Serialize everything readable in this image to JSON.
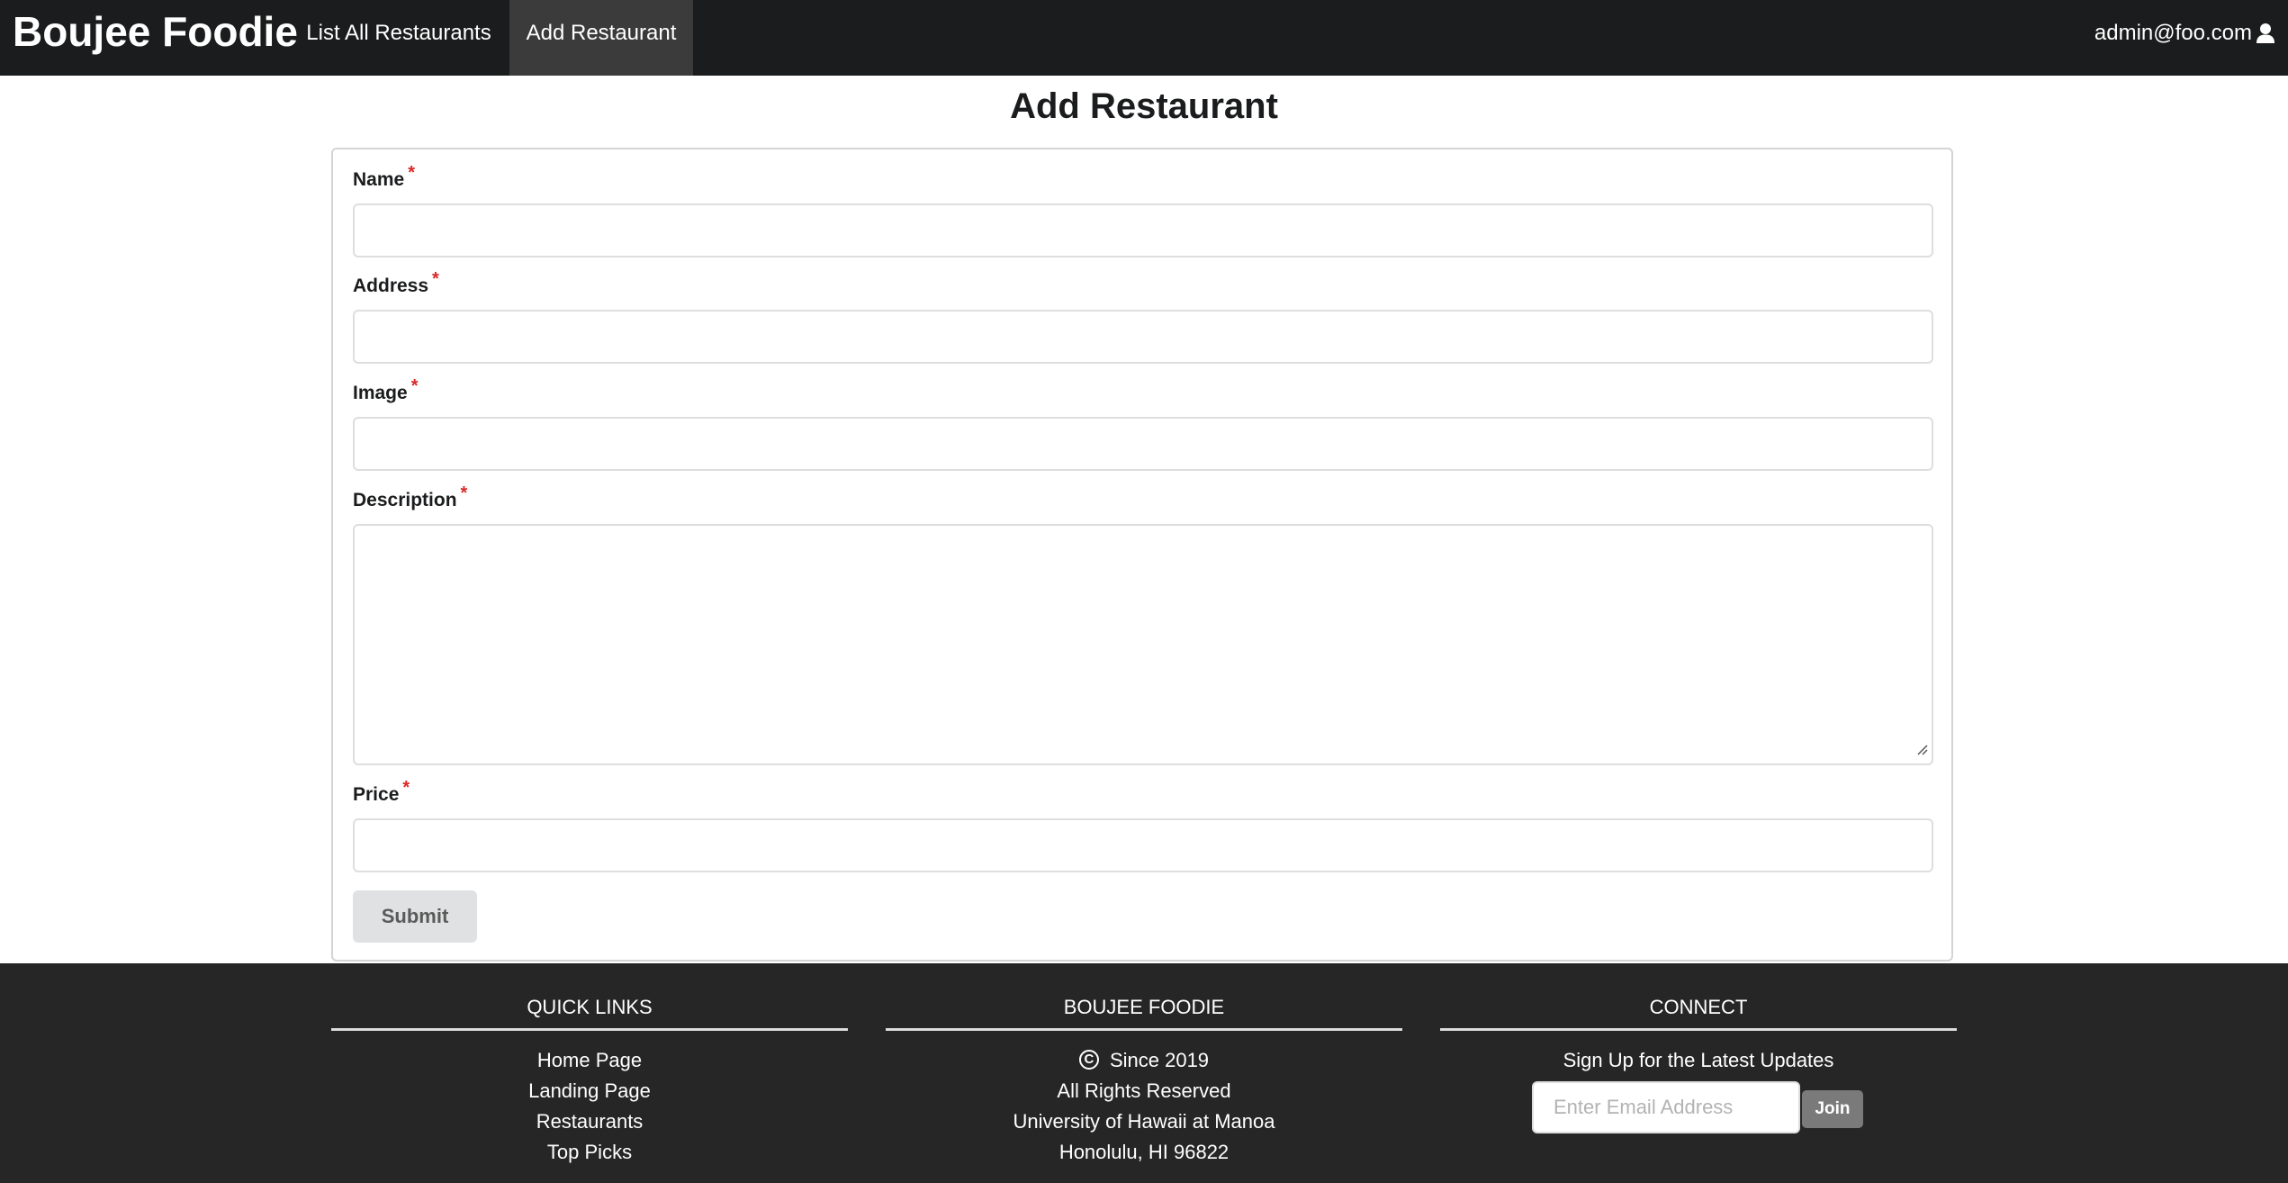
{
  "navbar": {
    "brand": "Boujee Foodie",
    "items": [
      {
        "label": "List All Restaurants",
        "active": false
      },
      {
        "label": "Add Restaurant",
        "active": true
      }
    ],
    "user": "admin@foo.com",
    "user_icon": "user-icon"
  },
  "page": {
    "title": "Add Restaurant"
  },
  "form": {
    "required_mark": "*",
    "fields": {
      "name": {
        "label": "Name",
        "value": ""
      },
      "address": {
        "label": "Address",
        "value": ""
      },
      "image": {
        "label": "Image",
        "value": ""
      },
      "description": {
        "label": "Description",
        "value": ""
      },
      "price": {
        "label": "Price",
        "value": ""
      }
    },
    "submit_label": "Submit"
  },
  "footer": {
    "quick_links": {
      "heading": "QUICK LINKS",
      "links": [
        "Home Page",
        "Landing Page",
        "Restaurants",
        "Top Picks"
      ]
    },
    "about": {
      "heading": "BOUJEE FOODIE",
      "copyright_symbol": "C",
      "lines": [
        "Since 2019",
        "All Rights Reserved",
        "University of Hawaii at Manoa",
        "Honolulu, HI 96822"
      ]
    },
    "connect": {
      "heading": "CONNECT",
      "signup_text": "Sign Up for the Latest Updates",
      "email_placeholder": "Enter Email Address",
      "join_label": "Join"
    }
  },
  "colors": {
    "navbar_bg": "#1b1c1d",
    "active_nav_bg": "#3b3b3c",
    "footer_bg": "#262626",
    "required": "#db2828",
    "submit_bg": "#e0e1e2"
  }
}
